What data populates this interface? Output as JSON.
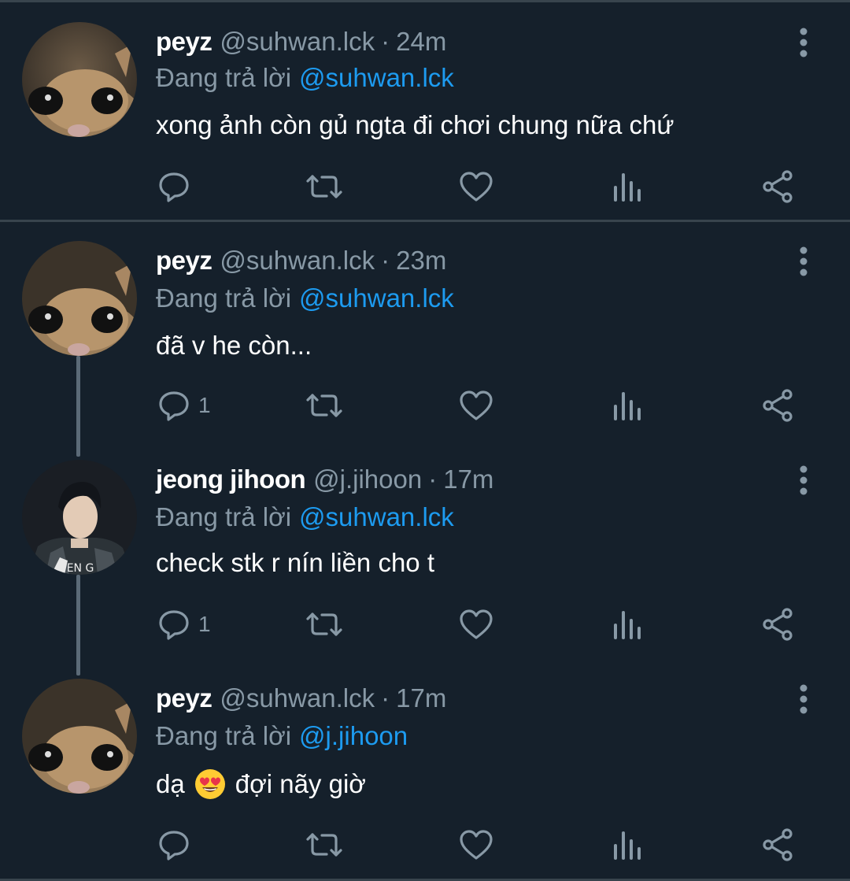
{
  "reply_prefix": "Đang trả lời",
  "colors": {
    "background": "#15202b",
    "secondary": "#8899a6",
    "mention": "#1d9bf0",
    "divider": "#38444d"
  },
  "tweets": [
    {
      "name": "peyz",
      "handle": "@suhwan.lck",
      "separator": "·",
      "time": "24m",
      "reply_to": "@suhwan.lck",
      "text": "xong ảnh còn gủ ngta đi chơi chung nữa chứ",
      "reply_count": "",
      "avatar": "cat-avatar"
    },
    {
      "name": "peyz",
      "handle": "@suhwan.lck",
      "separator": "·",
      "time": "23m",
      "reply_to": "@suhwan.lck",
      "text": "đã v he còn...",
      "reply_count": "1",
      "avatar": "cat-avatar"
    },
    {
      "name": "jeong jihoon",
      "handle": "@j.jihoon",
      "separator": "·",
      "time": "17m",
      "reply_to": "@suhwan.lck",
      "text": "check stk r nín liền cho t",
      "reply_count": "1",
      "avatar": "person-avatar"
    },
    {
      "name": "peyz",
      "handle": "@suhwan.lck",
      "separator": "·",
      "time": "17m",
      "reply_to": "@j.jihoon",
      "text_before": "dạ",
      "emoji": "heart-eyes-emoji",
      "text_after": "đợi nãy giờ",
      "reply_count": "",
      "avatar": "cat-avatar"
    }
  ]
}
